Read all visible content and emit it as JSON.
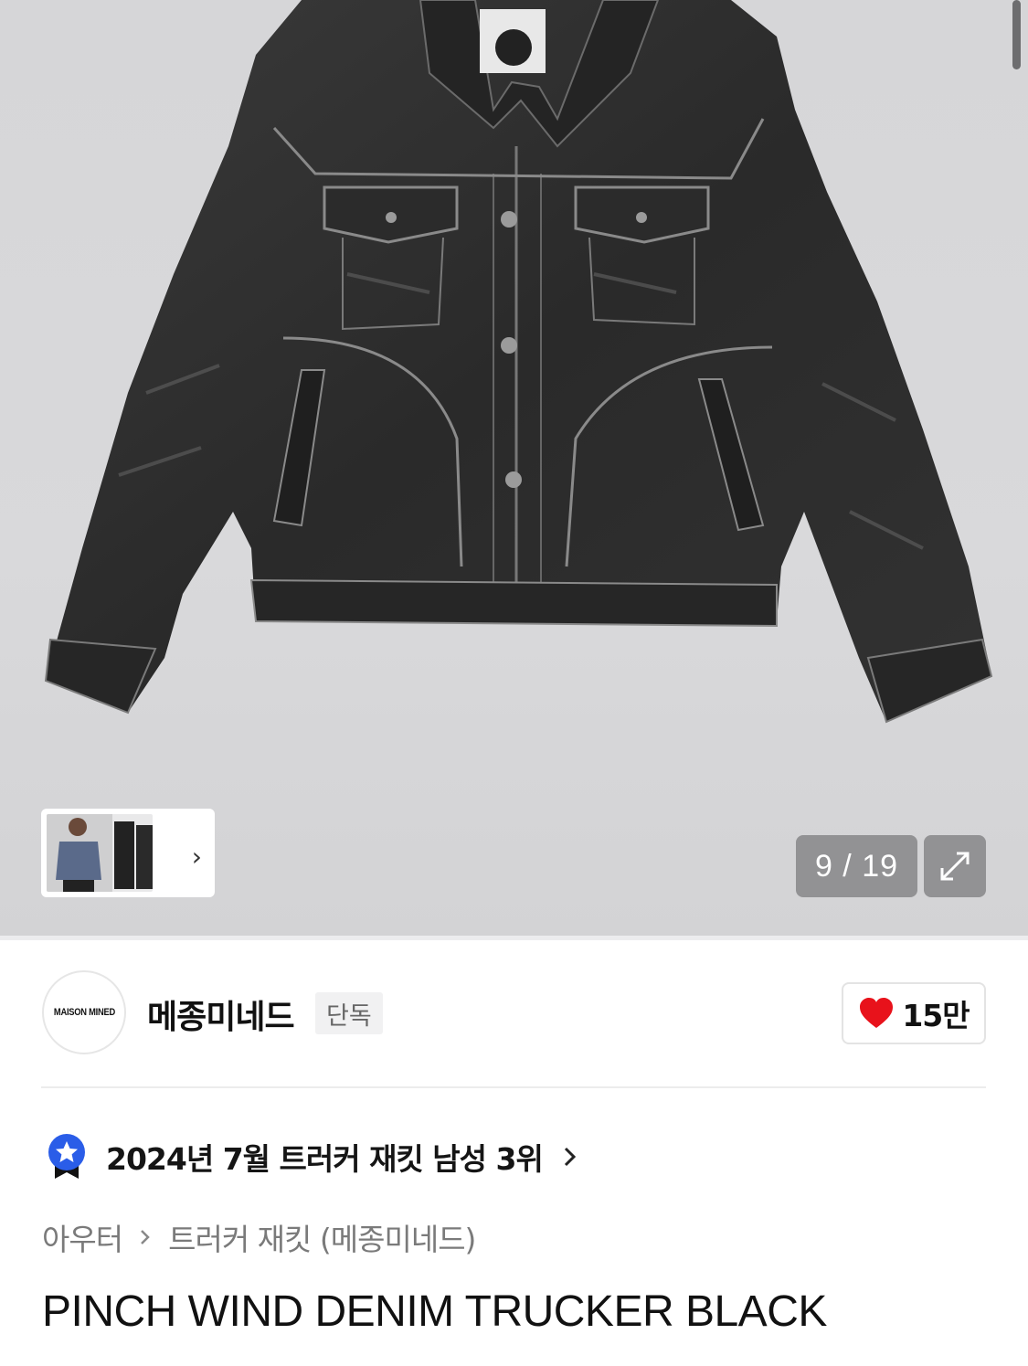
{
  "gallery": {
    "current": 9,
    "total": 19,
    "counter_text": "9 / 19"
  },
  "brand": {
    "logo_text": "MAISON MINED",
    "name": "메종미네드",
    "badge": "단독"
  },
  "like": {
    "count": "15만",
    "liked": true,
    "color": "#e8121b"
  },
  "ranking": {
    "text": "2024년 7월 트러커 재킷 남성 3위",
    "badge_color": "#2a5de8"
  },
  "breadcrumb": {
    "category": "아우터",
    "subcategory": "트러커 재킷 (메종미네드)"
  },
  "product": {
    "title": "PINCH WIND DENIM TRUCKER BLACK"
  },
  "icons": {
    "expand": "expand-arrows-icon",
    "chevron": "chevron-right-icon",
    "heart": "heart-icon",
    "rank": "star-ribbon-icon"
  }
}
